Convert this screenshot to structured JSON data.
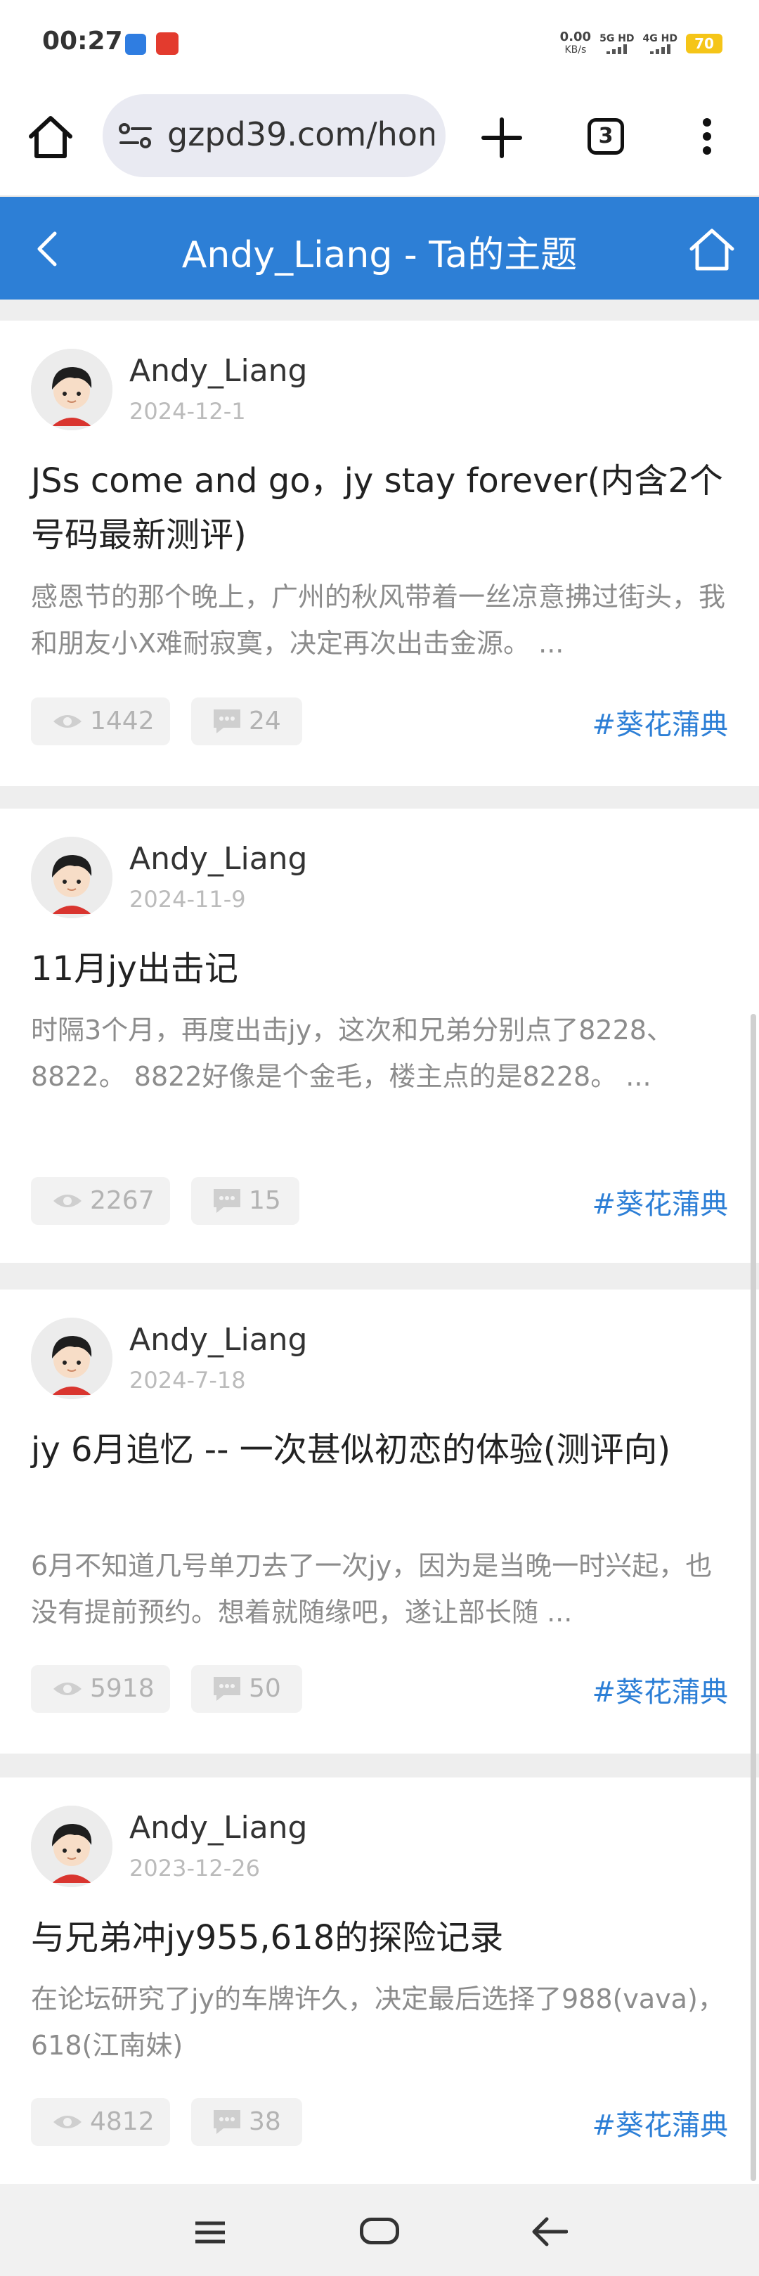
{
  "status_bar": {
    "time": "00:27",
    "speed_value": "0.00",
    "speed_unit": "KB/s",
    "sim1": "5G HD",
    "sim2": "4G HD",
    "battery": "70"
  },
  "browser": {
    "url": "gzpd39.com/hom",
    "tab_count": "3"
  },
  "header": {
    "title": "Andy_Liang - Ta的主题"
  },
  "posts": [
    {
      "author": "Andy_Liang",
      "date": "2024-12-1",
      "title": "JSs come and go，jy stay forever(内含2个号码最新测评)",
      "excerpt": "感恩节的那个晚上，广州的秋风带着一丝凉意拂过街头，我和朋友小X难耐寂寞，决定再次出击金源。 ...",
      "views": "1442",
      "comments": "24",
      "tag": "#葵花蒲典"
    },
    {
      "author": "Andy_Liang",
      "date": "2024-11-9",
      "title": "11月jy出击记",
      "excerpt": "时隔3个月，再度出击jy，这次和兄弟分别点了8228、8822。 8822好像是个金毛，楼主点的是8228。 ...",
      "views": "2267",
      "comments": "15",
      "tag": "#葵花蒲典"
    },
    {
      "author": "Andy_Liang",
      "date": "2024-7-18",
      "title": "jy 6月追忆 -- 一次甚似初恋的体验(测评向)",
      "excerpt": "6月不知道几号单刀去了一次jy，因为是当晚一时兴起，也没有提前预约。想着就随缘吧，遂让部长随 ...",
      "views": "5918",
      "comments": "50",
      "tag": "#葵花蒲典"
    },
    {
      "author": "Andy_Liang",
      "date": "2023-12-26",
      "title": "与兄弟冲jy955,618的探险记录",
      "excerpt": "在论坛研究了jy的车牌许久，决定最后选择了988(vava)，618(江南妹)",
      "views": "4812",
      "comments": "38",
      "tag": "#葵花蒲典"
    }
  ]
}
